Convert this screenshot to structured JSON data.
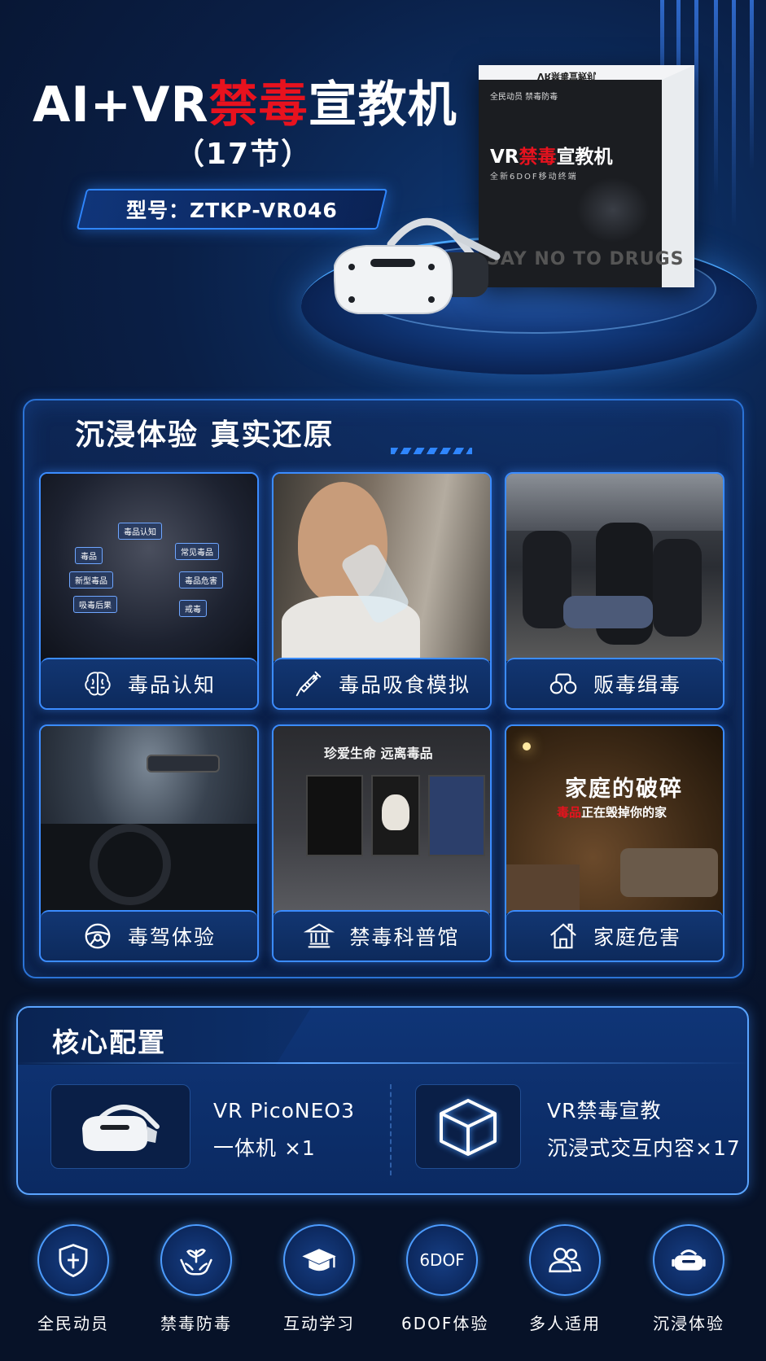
{
  "header": {
    "title_prefix": "AI+VR",
    "title_highlight": "禁毒",
    "title_suffix": "宣教机",
    "subtitle": "（17节）",
    "model": "型号：ZTKP-VR046"
  },
  "product_box": {
    "top_text": "VR禁毒宣教机",
    "corner_text": "全民动员  禁毒防毒",
    "title_prefix": "VR",
    "title_highlight": "禁毒",
    "title_suffix": "宣教机",
    "subtitle": "全新6DOF移动终端",
    "slogan": "SAY NO TO DRUGS"
  },
  "section_experience": {
    "title": "沉浸体验  真实还原",
    "cards": [
      {
        "label": "毒品认知",
        "icon": "brain-icon"
      },
      {
        "label": "毒品吸食模拟",
        "icon": "syringe-icon"
      },
      {
        "label": "贩毒缉毒",
        "icon": "handcuffs-icon"
      },
      {
        "label": "毒驾体验",
        "icon": "steering-wheel-icon"
      },
      {
        "label": "禁毒科普馆",
        "icon": "museum-icon"
      },
      {
        "label": "家庭危害",
        "icon": "house-icon"
      }
    ],
    "card1_chips": [
      "毒品认知",
      "毒品",
      "常见毒品",
      "新型毒品",
      "毒品危害",
      "吸毒后果",
      "戒毒"
    ],
    "card5_image": {
      "title": "珍爱生命   远离毒品"
    },
    "card6_image": {
      "title": "家庭的破碎",
      "sub_highlight": "毒品",
      "sub_rest": "正在毁掉你的家"
    }
  },
  "section_config": {
    "title": "核心配置",
    "items": [
      {
        "line1": "VR PicoNEO3",
        "line2": "一体机 ×1",
        "icon": "vr-headset-icon"
      },
      {
        "line1": "VR禁毒宣教",
        "line2": "沉浸式交互内容×17",
        "icon": "cube-icon"
      }
    ]
  },
  "features": [
    {
      "label": "全民动员",
      "icon": "shield-icon"
    },
    {
      "label": "禁毒防毒",
      "icon": "hands-plant-icon"
    },
    {
      "label": "互动学习",
      "icon": "graduation-cap-icon"
    },
    {
      "label": "6DOF体验",
      "icon": "6dof-icon",
      "icon_text": "6DOF"
    },
    {
      "label": "多人适用",
      "icon": "group-icon"
    },
    {
      "label": "沉浸体验",
      "icon": "vr-headset-icon"
    }
  ],
  "colors": {
    "accent_red": "#e8121e",
    "accent_blue": "#3b8cff",
    "background": "#0a1f46"
  }
}
